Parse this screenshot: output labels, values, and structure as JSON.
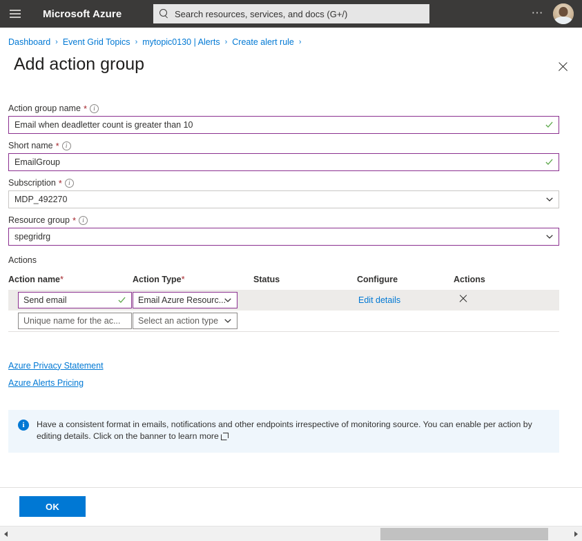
{
  "topbar": {
    "menu_icon": "hamburger-icon",
    "brand": "Microsoft Azure",
    "search_placeholder": "Search resources, services, and docs (G+/)",
    "search_icon": "search-icon",
    "more_icon": "ellipsis-icon",
    "avatar": "user-avatar"
  },
  "breadcrumb": {
    "items": [
      {
        "label": "Dashboard"
      },
      {
        "label": "Event Grid Topics"
      },
      {
        "label": "mytopic0130 | Alerts"
      },
      {
        "label": "Create alert rule"
      }
    ],
    "separator": "›"
  },
  "header": {
    "title": "Add action group",
    "close_icon": "close-icon"
  },
  "form": {
    "fields": [
      {
        "label": "Action group name",
        "required": "*",
        "info_icon": "info-icon",
        "value": "Email when deadletter count is greater than 10",
        "control": "text",
        "valid": true,
        "border": "accent"
      },
      {
        "label": "Short name",
        "required": "*",
        "info_icon": "info-icon",
        "value": "EmailGroup",
        "control": "text",
        "valid": true,
        "border": "accent"
      },
      {
        "label": "Subscription",
        "required": "*",
        "info_icon": "info-icon",
        "value": "MDP_492270",
        "control": "select",
        "valid": false,
        "border": "gray"
      },
      {
        "label": "Resource group",
        "required": "*",
        "info_icon": "info-icon",
        "value": "spegridrg",
        "control": "select",
        "valid": false,
        "border": "accent"
      }
    ]
  },
  "actions": {
    "section_label": "Actions",
    "columns": [
      {
        "label": "Action name",
        "required": "*"
      },
      {
        "label": "Action Type",
        "required": "*"
      },
      {
        "label": "Status",
        "required": ""
      },
      {
        "label": "Configure",
        "required": ""
      },
      {
        "label": "Actions",
        "required": ""
      }
    ],
    "rows": [
      {
        "name_value": "Send email",
        "name_is_placeholder": false,
        "name_valid": true,
        "type_value": "Email Azure Resourc...",
        "type_is_placeholder": false,
        "status": "",
        "configure_label": "Edit details",
        "delete_icon": "close-icon",
        "filled": true
      },
      {
        "name_value": "Unique name for the ac...",
        "name_is_placeholder": true,
        "name_valid": false,
        "type_value": "Select an action type",
        "type_is_placeholder": true,
        "status": "",
        "configure_label": "",
        "delete_icon": "",
        "filled": false
      }
    ]
  },
  "links": [
    {
      "label": "Azure Privacy Statement"
    },
    {
      "label": "Azure Alerts Pricing"
    }
  ],
  "banner": {
    "icon": "info-icon",
    "text": "Have a consistent format in emails, notifications and other endpoints irrespective of monitoring source. You can enable per action by editing details. Click on the banner to learn more",
    "external_icon": "external-link-icon"
  },
  "footer": {
    "ok_label": "OK"
  },
  "scrollbar": {
    "left_arrow": "arrow-left-icon",
    "right_arrow": "arrow-right-icon"
  },
  "colors": {
    "chrome": "#3b3a39",
    "accent_border": "#8a2f8f",
    "link": "#0078d4",
    "primary_button": "#0078d4",
    "required_mark": "#a4262c",
    "valid_check": "#5ca84a",
    "row_filled": "#edebe9",
    "banner_bg": "#eff6fc"
  }
}
